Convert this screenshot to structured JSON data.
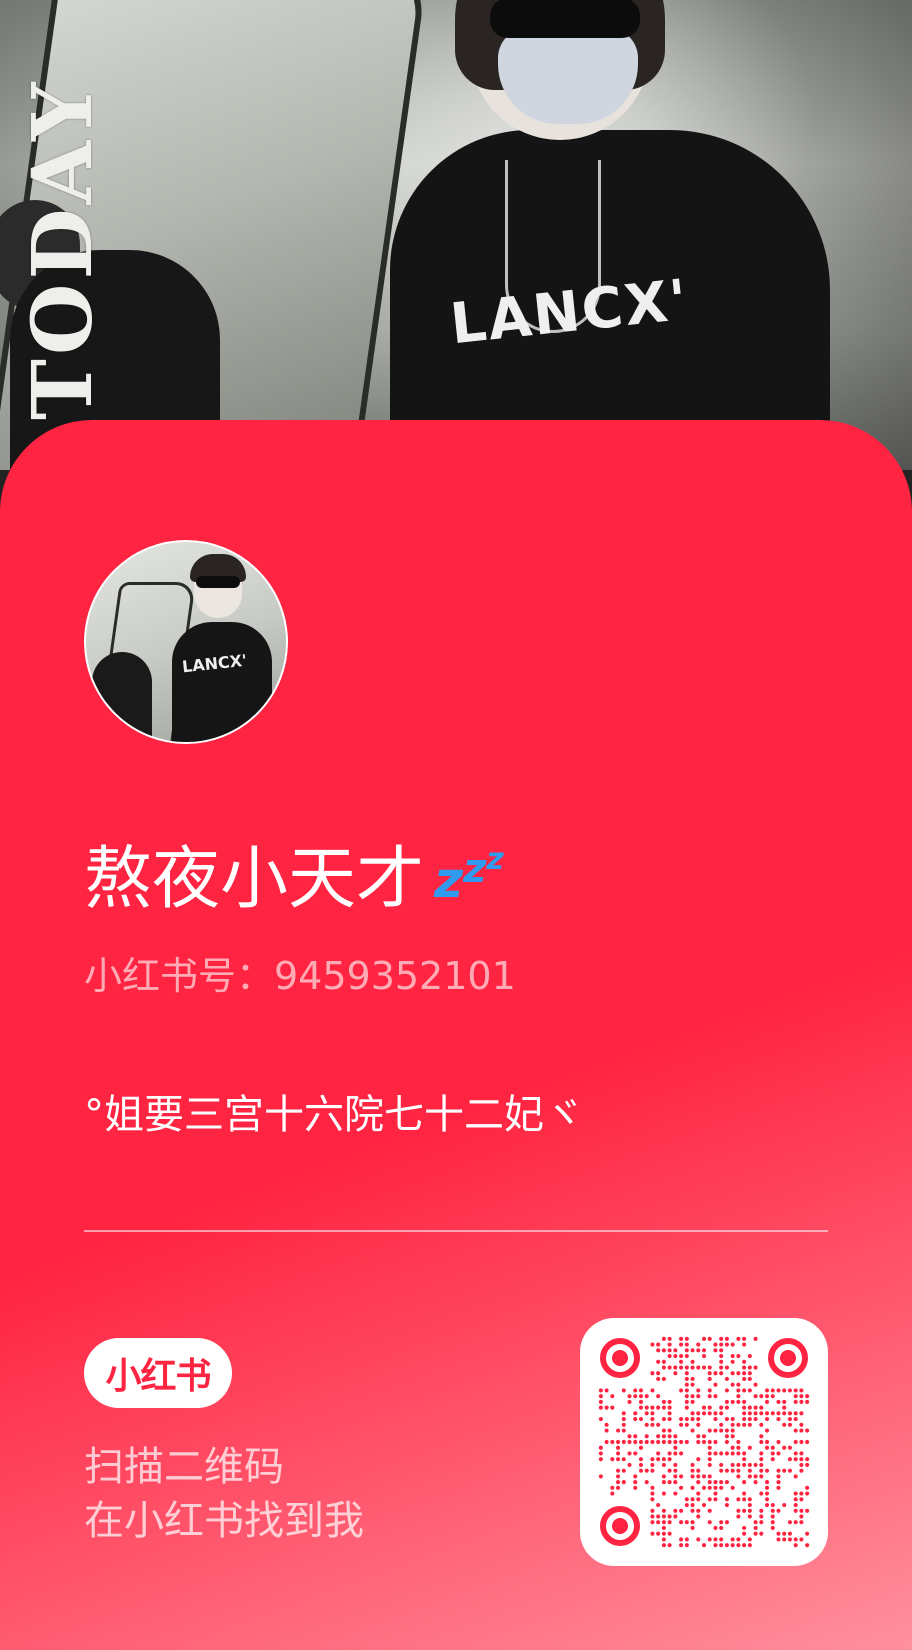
{
  "hero": {
    "vertical_word": "TODAY",
    "shirt_print": "LANCX'"
  },
  "profile": {
    "nickname": "熬夜小天才",
    "nickname_emoji": [
      "z",
      "z",
      "z"
    ],
    "id_label": "小红书号：9459352101",
    "bio": "°姐要三宫十六院七十二妃ヾ"
  },
  "footer": {
    "logo_text": "小红书",
    "scan_line_1": "扫描二维码",
    "scan_line_2": "在小红书找到我"
  },
  "colors": {
    "brand_red": "#ff2441",
    "emoji_blue": "#2f9bf0"
  },
  "icons": {
    "avatar": "user-avatar-photo",
    "qr": "qr-code",
    "sleep": "zzz-emoji-icon"
  }
}
